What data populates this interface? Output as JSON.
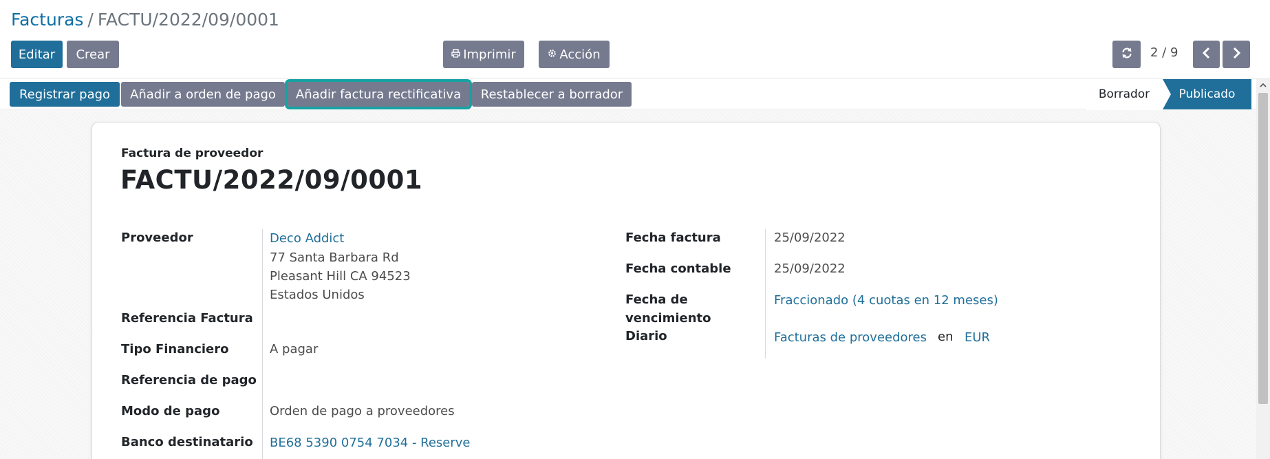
{
  "breadcrumb": {
    "parent": "Facturas",
    "separator": "/",
    "current": "FACTU/2022/09/0001"
  },
  "toolbar": {
    "edit_label": "Editar",
    "create_label": "Crear",
    "print_label": "Imprimir",
    "action_label": "Acción"
  },
  "pager": {
    "value": "2 / 9"
  },
  "statusbar": {
    "buttons": [
      {
        "label": "Registrar pago"
      },
      {
        "label": "Añadir a orden de pago"
      },
      {
        "label": "Añadir factura rectificativa"
      },
      {
        "label": "Restablecer a borrador"
      }
    ],
    "stages": [
      {
        "label": "Borrador",
        "active": false
      },
      {
        "label": "Publicado",
        "active": true
      }
    ]
  },
  "document": {
    "type": "Factura de proveedor",
    "number": "FACTU/2022/09/0001"
  },
  "left_fields": {
    "partner_label": "Proveedor",
    "partner_name": "Deco Addict",
    "partner_address": [
      "77 Santa Barbara Rd",
      "Pleasant Hill CA 94523",
      "Estados Unidos"
    ],
    "ref_label": "Referencia Factura",
    "ref_value": "",
    "fin_type_label": "Tipo Financiero",
    "fin_type_value": "A pagar",
    "payment_ref_label": "Referencia de pago",
    "payment_ref_value": "",
    "payment_mode_label": "Modo de pago",
    "payment_mode_value": "Orden de pago a proveedores",
    "bank_label": "Banco destinatario",
    "bank_value": "BE68 5390 0754 7034 - Reserve"
  },
  "right_fields": {
    "invoice_date_label": "Fecha factura",
    "invoice_date_value": "25/09/2022",
    "accounting_date_label": "Fecha contable",
    "accounting_date_value": "25/09/2022",
    "due_date_label_1": "Fecha de",
    "due_date_label_2": "vencimiento",
    "due_date_value": "Fraccionado (4 cuotas en 12 meses)",
    "journal_label": "Diario",
    "journal_value": "Facturas de proveedores",
    "journal_in": "en",
    "currency_value": "EUR"
  },
  "colors": {
    "primary": "#1f6f9a",
    "secondary": "#757a8f",
    "highlight": "#17a2a2"
  }
}
